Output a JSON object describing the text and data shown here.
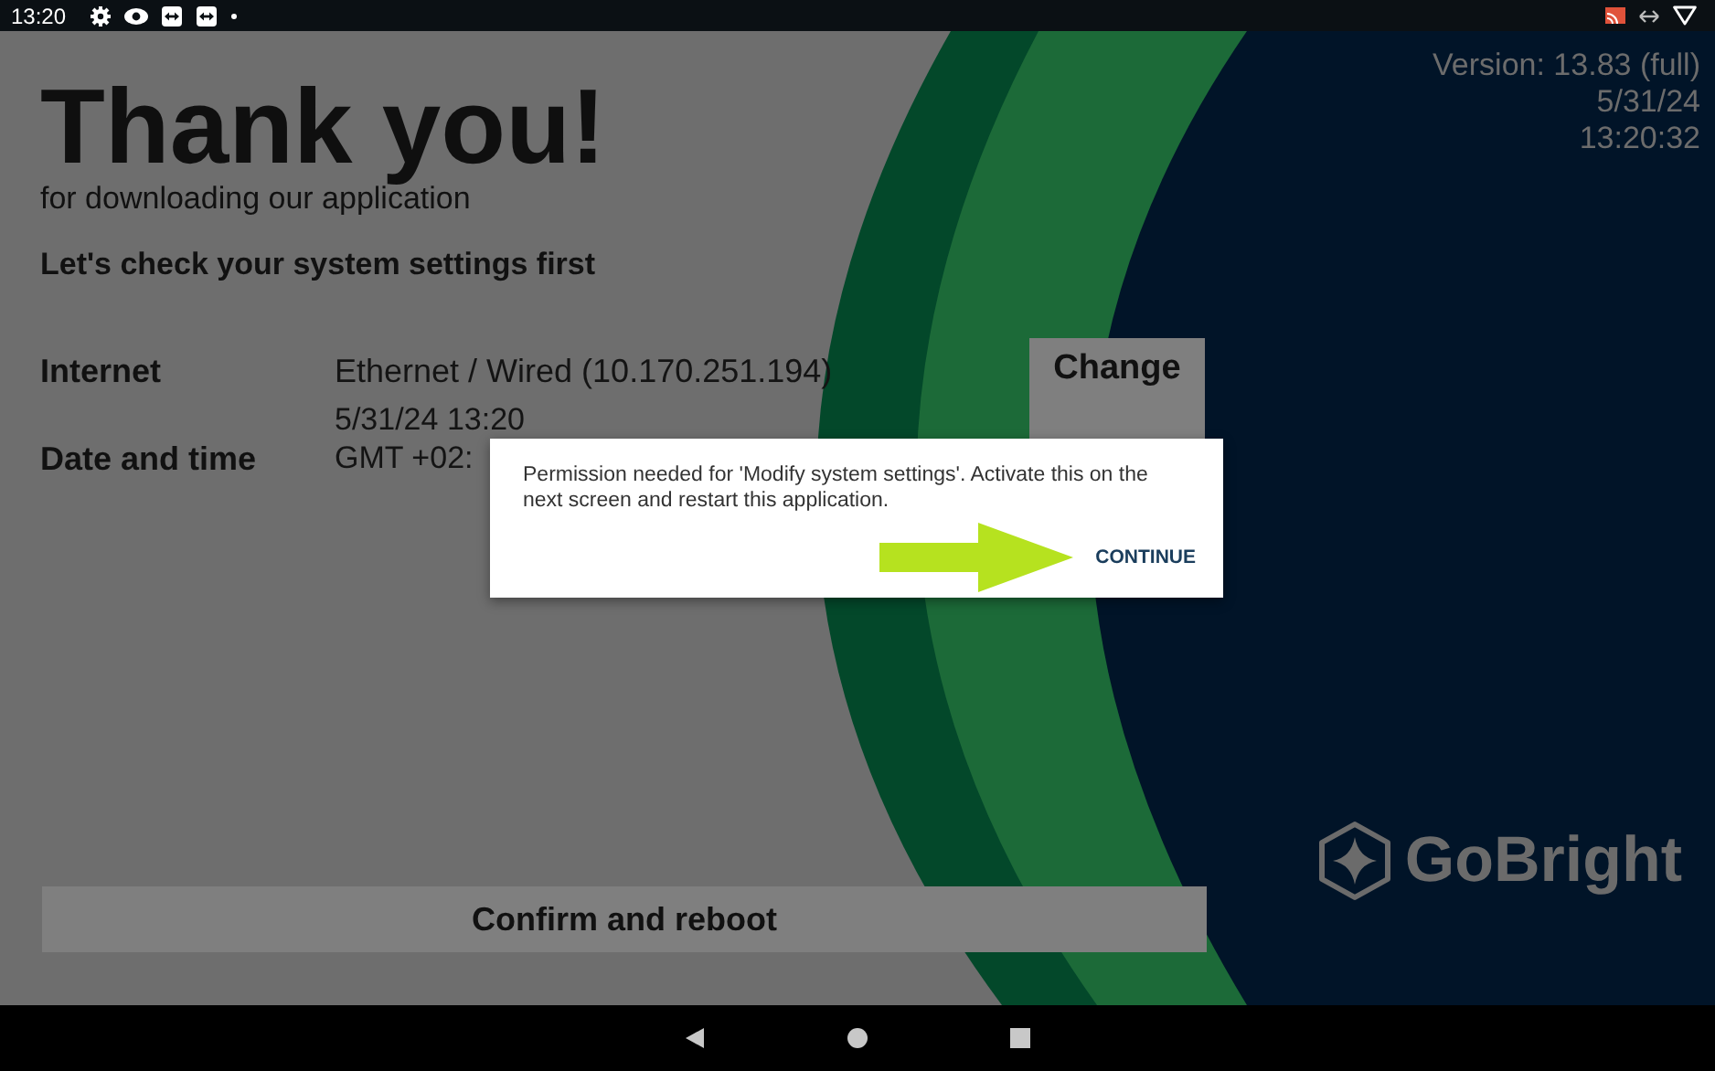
{
  "status_bar": {
    "time": "13:20"
  },
  "header": {
    "title": "Thank you!",
    "subtitle": "for downloading our application",
    "heading": "Let's check your system settings first"
  },
  "version_info": [
    "Version: 13.83 (full)",
    "5/31/24",
    "13:20:32"
  ],
  "settings": [
    {
      "label": "Internet",
      "value_lines": [
        "Ethernet / Wired (10.170.251.194)"
      ],
      "button": {
        "label": "Change",
        "covered": false
      }
    },
    {
      "label": "Date and time",
      "value_lines": [
        "5/31/24 13:20",
        "GMT +02:"
      ],
      "button": {
        "covered": true
      }
    }
  ],
  "confirm_button": "Confirm and reboot",
  "logo": "GoBright",
  "dialog": {
    "message": "Permission needed for 'Modify system settings'. Activate this on the next screen and restart this application.",
    "action": "CONTINUE"
  }
}
